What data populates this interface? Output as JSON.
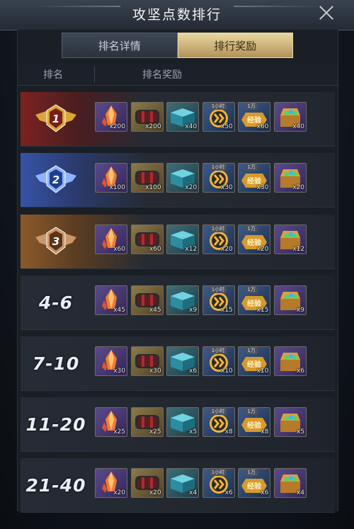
{
  "title": "攻坚点数排行",
  "tabs": [
    "排名详情",
    "排行奖励"
  ],
  "columns": [
    "排名",
    "排名奖励"
  ],
  "tags": {
    "time": "1小时",
    "exp": "1万",
    "exp_text": "经验"
  },
  "rows": [
    {
      "rank": "1",
      "qty": [
        "x200",
        "x200",
        "x40",
        "x50",
        "x60",
        "x40"
      ]
    },
    {
      "rank": "2",
      "qty": [
        "x100",
        "x100",
        "x20",
        "x30",
        "x30",
        "x20"
      ]
    },
    {
      "rank": "3",
      "qty": [
        "x60",
        "x60",
        "x12",
        "x20",
        "x20",
        "x12"
      ]
    },
    {
      "rank": "4-6",
      "qty": [
        "x45",
        "x45",
        "x9",
        "x15",
        "x15",
        "x9"
      ]
    },
    {
      "rank": "7-10",
      "qty": [
        "x30",
        "x30",
        "x6",
        "x10",
        "x10",
        "x6"
      ]
    },
    {
      "rank": "11-20",
      "qty": [
        "x25",
        "x25",
        "x5",
        "x8",
        "x8",
        "x5"
      ]
    },
    {
      "rank": "21-40",
      "qty": [
        "x20",
        "x20",
        "x4",
        "x6",
        "x6",
        "x4"
      ]
    }
  ]
}
